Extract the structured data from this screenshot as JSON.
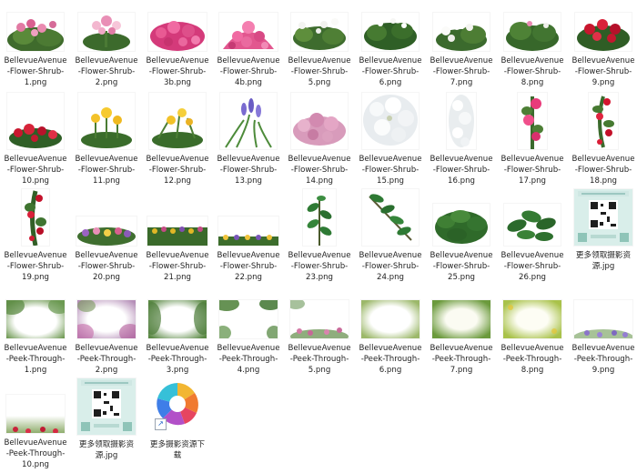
{
  "files": [
    {
      "label": "BellevueAvenue\n-Flower-Shrub-\n1.png",
      "icon": "flower-shrub-thumbnail"
    },
    {
      "label": "BellevueAvenue\n-Flower-Shrub-\n2.png",
      "icon": "flower-shrub-thumbnail"
    },
    {
      "label": "BellevueAvenue\n-Flower-Shrub-\n3b.png",
      "icon": "flower-shrub-thumbnail"
    },
    {
      "label": "BellevueAvenue\n-Flower-Shrub-\n4b.png",
      "icon": "flower-shrub-thumbnail"
    },
    {
      "label": "BellevueAvenue\n-Flower-Shrub-\n5.png",
      "icon": "flower-shrub-thumbnail"
    },
    {
      "label": "BellevueAvenue\n-Flower-Shrub-\n6.png",
      "icon": "flower-shrub-thumbnail"
    },
    {
      "label": "BellevueAvenue\n-Flower-Shrub-\n7.png",
      "icon": "flower-shrub-thumbnail"
    },
    {
      "label": "BellevueAvenue\n-Flower-Shrub-\n8.png",
      "icon": "flower-shrub-thumbnail"
    },
    {
      "label": "BellevueAvenue\n-Flower-Shrub-\n9.png",
      "icon": "flower-shrub-thumbnail"
    },
    {
      "label": "BellevueAvenue\n-Flower-Shrub-\n10.png",
      "icon": "flower-shrub-thumbnail"
    },
    {
      "label": "BellevueAvenue\n-Flower-Shrub-\n11.png",
      "icon": "flower-shrub-thumbnail"
    },
    {
      "label": "BellevueAvenue\n-Flower-Shrub-\n12.png",
      "icon": "flower-shrub-thumbnail"
    },
    {
      "label": "BellevueAvenue\n-Flower-Shrub-\n13.png",
      "icon": "flower-shrub-thumbnail"
    },
    {
      "label": "BellevueAvenue\n-Flower-Shrub-\n14.png",
      "icon": "flower-shrub-thumbnail"
    },
    {
      "label": "BellevueAvenue\n-Flower-Shrub-\n15.png",
      "icon": "flower-shrub-thumbnail"
    },
    {
      "label": "BellevueAvenue\n-Flower-Shrub-\n16.png",
      "icon": "flower-shrub-thumbnail"
    },
    {
      "label": "BellevueAvenue\n-Flower-Shrub-\n17.png",
      "icon": "flower-shrub-thumbnail"
    },
    {
      "label": "BellevueAvenue\n-Flower-Shrub-\n18.png",
      "icon": "flower-shrub-thumbnail"
    },
    {
      "label": "BellevueAvenue\n-Flower-Shrub-\n19.png",
      "icon": "flower-shrub-thumbnail"
    },
    {
      "label": "BellevueAvenue\n-Flower-Shrub-\n20.png",
      "icon": "flower-shrub-thumbnail"
    },
    {
      "label": "BellevueAvenue\n-Flower-Shrub-\n21.png",
      "icon": "flower-shrub-thumbnail"
    },
    {
      "label": "BellevueAvenue\n-Flower-Shrub-\n22.png",
      "icon": "flower-shrub-thumbnail"
    },
    {
      "label": "BellevueAvenue\n-Flower-Shrub-\n23.png",
      "icon": "flower-shrub-thumbnail"
    },
    {
      "label": "BellevueAvenue\n-Flower-Shrub-\n24.png",
      "icon": "flower-shrub-thumbnail"
    },
    {
      "label": "BellevueAvenue\n-Flower-Shrub-\n25.png",
      "icon": "flower-shrub-thumbnail"
    },
    {
      "label": "BellevueAvenue\n-Flower-Shrub-\n26.png",
      "icon": "flower-shrub-thumbnail"
    },
    {
      "label": "更多领取摄影资\n源.jpg",
      "icon": "qr-code-thumbnail"
    },
    {
      "label": "BellevueAvenue\n-Peek-Through-\n1.png",
      "icon": "peek-through-thumbnail"
    },
    {
      "label": "BellevueAvenue\n-Peek-Through-\n2.png",
      "icon": "peek-through-thumbnail"
    },
    {
      "label": "BellevueAvenue\n-Peek-Through-\n3.png",
      "icon": "peek-through-thumbnail"
    },
    {
      "label": "BellevueAvenue\n-Peek-Through-\n4.png",
      "icon": "peek-through-thumbnail"
    },
    {
      "label": "BellevueAvenue\n-Peek-Through-\n5.png",
      "icon": "peek-through-thumbnail"
    },
    {
      "label": "BellevueAvenue\n-Peek-Through-\n6.png",
      "icon": "peek-through-thumbnail"
    },
    {
      "label": "BellevueAvenue\n-Peek-Through-\n7.png",
      "icon": "peek-through-thumbnail"
    },
    {
      "label": "BellevueAvenue\n-Peek-Through-\n8.png",
      "icon": "peek-through-thumbnail"
    },
    {
      "label": "BellevueAvenue\n-Peek-Through-\n9.png",
      "icon": "peek-through-thumbnail"
    },
    {
      "label": "BellevueAvenue\n-Peek-Through-\n10.png",
      "icon": "peek-through-thumbnail"
    },
    {
      "label": "更多领取摄影资\n源.jpg",
      "icon": "qr-code-thumbnail"
    },
    {
      "label": "更多摄影资源下\n载",
      "icon": "pinwheel-shortcut-icon"
    }
  ]
}
